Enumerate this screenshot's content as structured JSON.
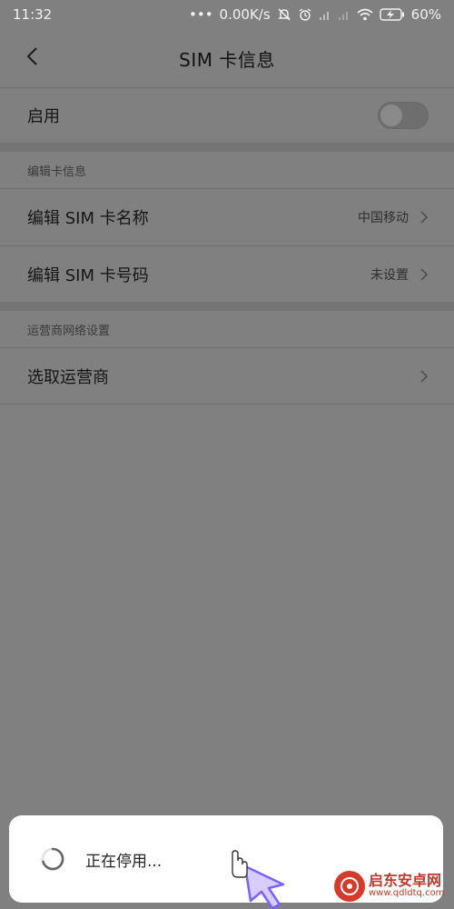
{
  "status_bar": {
    "time": "11:32",
    "dots": "•••",
    "network_speed": "0.00K/s",
    "battery": "60%",
    "icons": [
      "mute-icon",
      "alarm-icon",
      "signal-icon",
      "signal-icon-2",
      "wifi-icon",
      "battery-charging-icon"
    ]
  },
  "header": {
    "title": "SIM  卡信息",
    "back_icon": "back-arrow-icon"
  },
  "enable_row": {
    "label": "启用",
    "toggle_on": false
  },
  "section_edit": {
    "header": "编辑卡信息",
    "items": [
      {
        "label": "编辑 SIM 卡名称",
        "value": "中国移动"
      },
      {
        "label": "编辑 SIM 卡号码",
        "value": "未设置"
      }
    ]
  },
  "section_carrier": {
    "header": "运营商网络设置",
    "items": [
      {
        "label": "选取运营商"
      }
    ]
  },
  "toast": {
    "text": "正在停用..."
  },
  "watermark": {
    "name": "启东安卓网",
    "url": "www.qdldtq.com"
  },
  "colors": {
    "background_dim": "#808080",
    "toast_bg": "#ffffff",
    "watermark": "#c0392b",
    "cursor": "#7b61ff"
  }
}
